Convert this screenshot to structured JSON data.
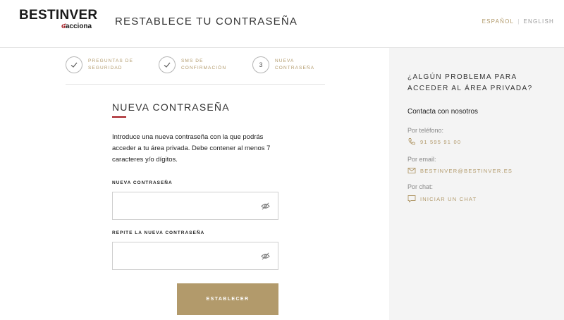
{
  "brand": {
    "name": "BESTINVER",
    "sub": "acciona"
  },
  "header": {
    "title": "RESTABLECE TU CONTRASEÑA"
  },
  "lang": {
    "active": "ESPAÑOL",
    "other": "ENGLISH"
  },
  "steps": [
    {
      "label_line1": "PREGUNTAS DE",
      "label_line2": "SEGURIDAD",
      "state": "done"
    },
    {
      "label_line1": "SMS DE",
      "label_line2": "CONFIRMACIÓN",
      "state": "done"
    },
    {
      "number": "3",
      "label_line1": "NUEVA",
      "label_line2": "CONTRASEÑA",
      "state": "current"
    }
  ],
  "form": {
    "title": "NUEVA CONTRASEÑA",
    "description": "Introduce una nueva contraseña con la que podrás acceder a tu área privada. Debe contener al menos 7 caracteres y/o dígitos.",
    "password_label": "NUEVA CONTRASEÑA",
    "password_value": "",
    "repeat_label": "REPITE LA NUEVA CONTRASEÑA",
    "repeat_value": "",
    "submit_label": "ESTABLECER"
  },
  "help": {
    "question": "¿ALGÚN PROBLEMA PARA ACCEDER AL ÁREA PRIVADA?",
    "contact_title": "Contacta con nosotros",
    "phone_label": "Por teléfono:",
    "phone": "91 595 91 00",
    "email_label": "Por email:",
    "email": "BESTINVER@BESTINVER.ES",
    "chat_label": "Por chat:",
    "chat": "INICIAR UN CHAT"
  },
  "colors": {
    "accent_gold": "#b29a6b",
    "accent_red": "#a3191f",
    "aside_bg": "#f4f4f4"
  },
  "icons": [
    "check-icon",
    "eye-off-icon",
    "phone-icon",
    "mail-icon",
    "chat-icon"
  ]
}
